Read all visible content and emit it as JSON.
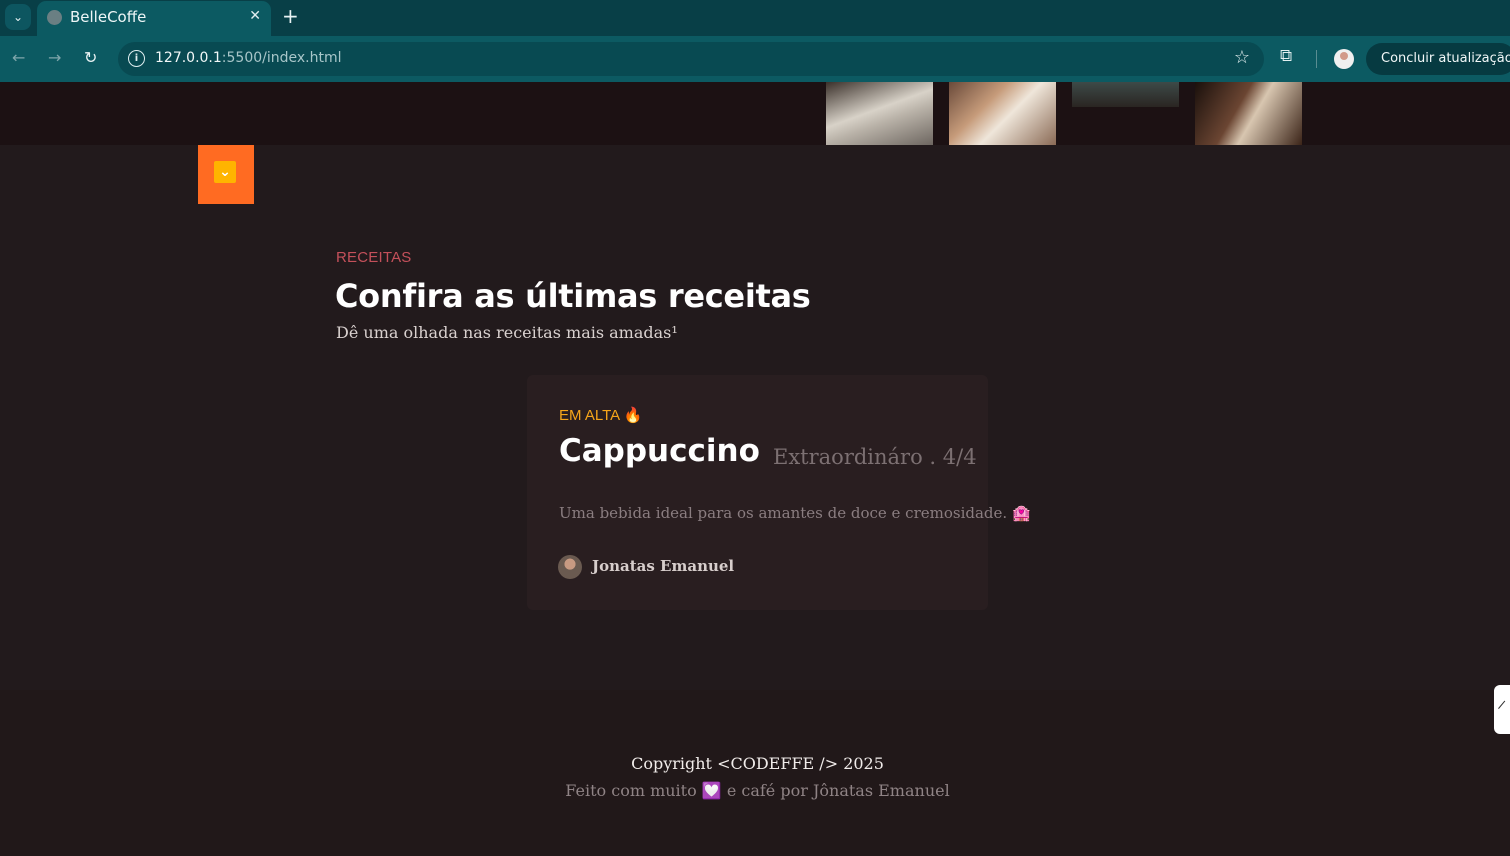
{
  "browser": {
    "tab_menu_icon": "chevron-down-icon",
    "tab_title": "BelleCoffe",
    "tab_close": "✕",
    "new_tab": "+",
    "url_host": "127.0.0.1",
    "url_rest": ":5500/index.html",
    "update_button": "Concluir atualização"
  },
  "hero": {
    "gallery_images": [
      "coffee-cup-on-tray",
      "hand-holding-cup",
      "coffee-beans",
      "woman-drinking-coffee"
    ],
    "scroll_icon": "double-chevron-down-icon"
  },
  "recipes": {
    "tag": "RECEITAS",
    "title": "Confira as últimas receitas",
    "subtitle": "Dê uma olhada nas receitas mais amadas¹",
    "card": {
      "badge": "EM ALTA 🔥",
      "name": "Cappuccino",
      "rating": "Extraordináro . 4/4",
      "description": "Uma bebida ideal para os amantes de doce e cremosidade. 🏩",
      "author": "Jonatas Emanuel"
    }
  },
  "footer": {
    "copyright": "Copyright <CODEFFE /> 2025",
    "made_with": "Feito com muito 💟 e café por Jônatas Emanuel"
  },
  "colors": {
    "page_bg": "#221a1c",
    "accent_orange": "#ff6b22",
    "accent_yellow": "#ffb400",
    "tag_red": "#c4505a",
    "badge_orange": "#f5a51a",
    "chrome_teal": "#0c5a62"
  }
}
